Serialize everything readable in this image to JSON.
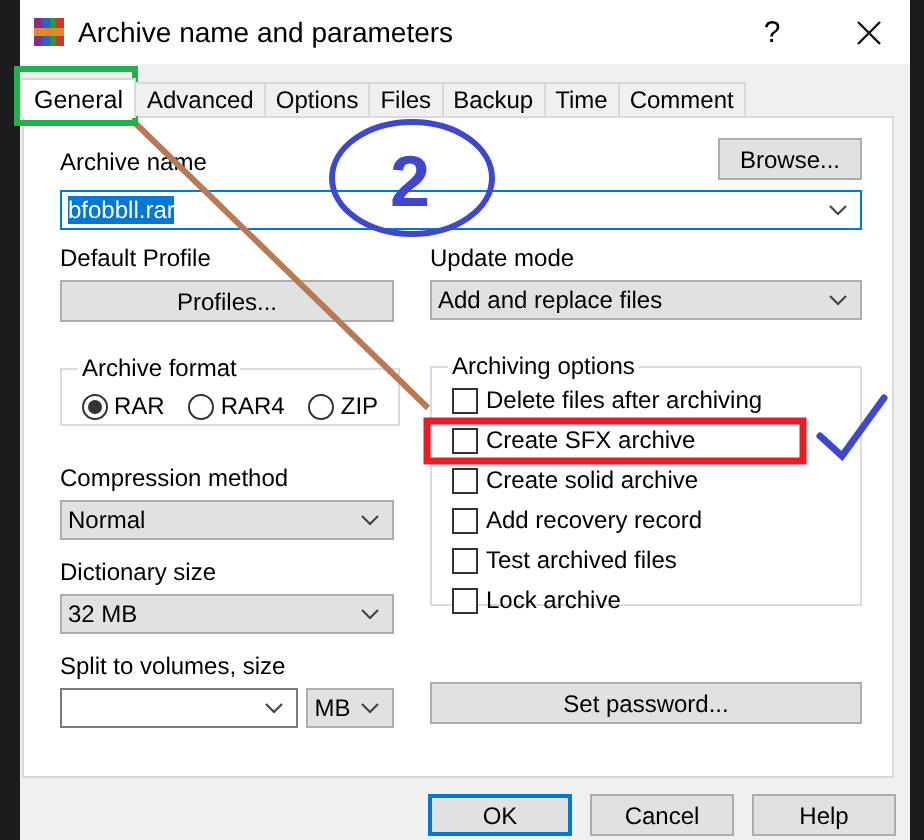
{
  "window": {
    "title": "Archive name and parameters",
    "help_button": "?"
  },
  "tabs": [
    {
      "label": "General",
      "selected": true
    },
    {
      "label": "Advanced",
      "selected": false
    },
    {
      "label": "Options",
      "selected": false
    },
    {
      "label": "Files",
      "selected": false
    },
    {
      "label": "Backup",
      "selected": false
    },
    {
      "label": "Time",
      "selected": false
    },
    {
      "label": "Comment",
      "selected": false
    }
  ],
  "archive_name": {
    "label": "Archive name",
    "value": "bfobbll.rar",
    "text_selected": true,
    "browse_button": "Browse..."
  },
  "default_profile": {
    "label": "Default Profile",
    "button": "Profiles..."
  },
  "update_mode": {
    "label": "Update mode",
    "value": "Add and replace files"
  },
  "archive_format": {
    "label": "Archive format",
    "options": [
      {
        "label": "RAR",
        "selected": true
      },
      {
        "label": "RAR4",
        "selected": false
      },
      {
        "label": "ZIP",
        "selected": false
      }
    ]
  },
  "archiving_options": {
    "label": "Archiving options",
    "options": [
      {
        "label": "Delete files after archiving",
        "checked": false
      },
      {
        "label": "Create SFX archive",
        "checked": false
      },
      {
        "label": "Create solid archive",
        "checked": false
      },
      {
        "label": "Add recovery record",
        "checked": false
      },
      {
        "label": "Test archived files",
        "checked": false
      },
      {
        "label": "Lock archive",
        "checked": false
      }
    ]
  },
  "compression_method": {
    "label": "Compression method",
    "value": "Normal"
  },
  "dictionary_size": {
    "label": "Dictionary size",
    "value": "32 MB"
  },
  "split_volumes": {
    "label": "Split to volumes, size",
    "unit": "MB"
  },
  "set_password_button": "Set password...",
  "buttons": [
    {
      "label": "OK",
      "default": true
    },
    {
      "label": "Cancel",
      "default": false
    },
    {
      "label": "Help",
      "default": false
    }
  ],
  "annotations": {
    "step": "2"
  }
}
